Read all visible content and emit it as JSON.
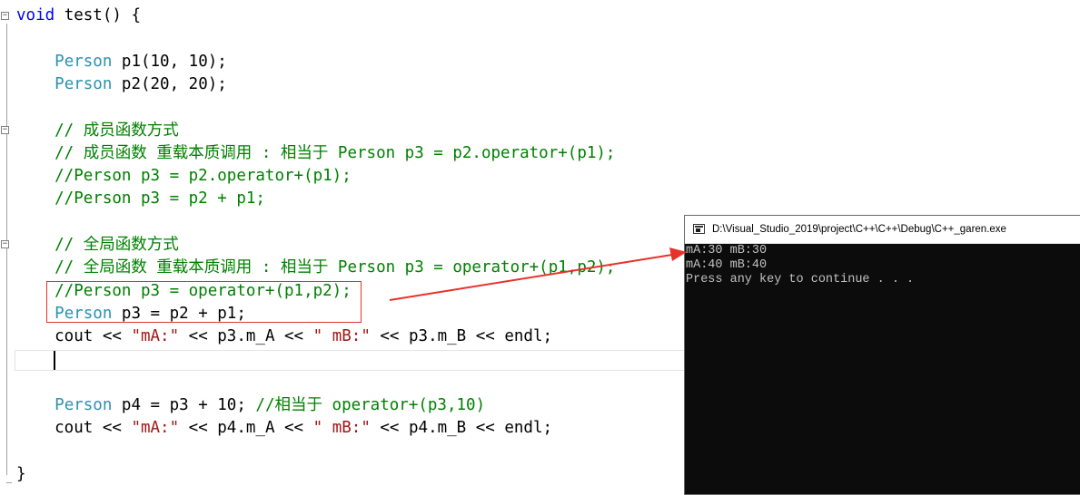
{
  "editor": {
    "lines": [
      [
        {
          "t": "void",
          "c": "kw"
        },
        {
          "t": " test() {",
          "c": "plain"
        }
      ],
      [],
      [
        {
          "t": "    ",
          "c": "plain"
        },
        {
          "t": "Person",
          "c": "ty"
        },
        {
          "t": " p1(10, 10);",
          "c": "plain"
        }
      ],
      [
        {
          "t": "    ",
          "c": "plain"
        },
        {
          "t": "Person",
          "c": "ty"
        },
        {
          "t": " p2(20, 20);",
          "c": "plain"
        }
      ],
      [],
      [
        {
          "t": "    // 成员函数方式",
          "c": "cm"
        }
      ],
      [
        {
          "t": "    // 成员函数 重载本质调用 : 相当于 Person p3 = p2.operator+(p1);",
          "c": "cm"
        }
      ],
      [
        {
          "t": "    //Person p3 = p2.operator+(p1);",
          "c": "cm"
        }
      ],
      [
        {
          "t": "    //Person p3 = p2 + p1;",
          "c": "cm"
        }
      ],
      [],
      [
        {
          "t": "    // 全局函数方式",
          "c": "cm"
        }
      ],
      [
        {
          "t": "    // 全局函数 重载本质调用 : 相当于 Person p3 = operator+(p1,p2);",
          "c": "cm"
        }
      ],
      [
        {
          "t": "    //Person p3 = operator+(p1,p2);",
          "c": "cm"
        }
      ],
      [
        {
          "t": "    ",
          "c": "plain"
        },
        {
          "t": "Person",
          "c": "ty"
        },
        {
          "t": " p3 = p2 + p1;",
          "c": "plain"
        }
      ],
      [
        {
          "t": "    cout << ",
          "c": "plain"
        },
        {
          "t": "\"mA:\"",
          "c": "st"
        },
        {
          "t": " << p3.m_A << ",
          "c": "plain"
        },
        {
          "t": "\" mB:\"",
          "c": "st"
        },
        {
          "t": " << p3.m_B << endl;",
          "c": "plain"
        }
      ],
      [],
      [],
      [
        {
          "t": "    ",
          "c": "plain"
        },
        {
          "t": "Person",
          "c": "ty"
        },
        {
          "t": " p4 = p3 + 10; ",
          "c": "plain"
        },
        {
          "t": "//相当于 operator+(p3,10)",
          "c": "cm"
        }
      ],
      [
        {
          "t": "    cout << ",
          "c": "plain"
        },
        {
          "t": "\"mA:\"",
          "c": "st"
        },
        {
          "t": " << p4.m_A << ",
          "c": "plain"
        },
        {
          "t": "\" mB:\"",
          "c": "st"
        },
        {
          "t": " << p4.m_B << endl;",
          "c": "plain"
        }
      ],
      [],
      [
        {
          "t": "}",
          "c": "plain"
        }
      ]
    ],
    "fold_markers": [
      "⊟",
      "⊟",
      "⊟"
    ]
  },
  "console": {
    "title": "D:\\Visual_Studio_2019\\project\\C++\\C++\\Debug\\C++_garen.exe",
    "lines": [
      "mA:30 mB:30",
      "mA:40 mB:40",
      "Press any key to continue . . ."
    ]
  },
  "colors": {
    "keyword": "#0000ff",
    "type": "#2b91af",
    "comment": "#008000",
    "string": "#a31515",
    "annotation_red": "#e8312b",
    "console_bg": "#0c0c0c",
    "console_text": "#c0c0c0"
  },
  "icons": {
    "fold": "collapse-box-icon",
    "console_app": "console-window-icon",
    "annotation_arrow": "red-arrow-icon"
  }
}
